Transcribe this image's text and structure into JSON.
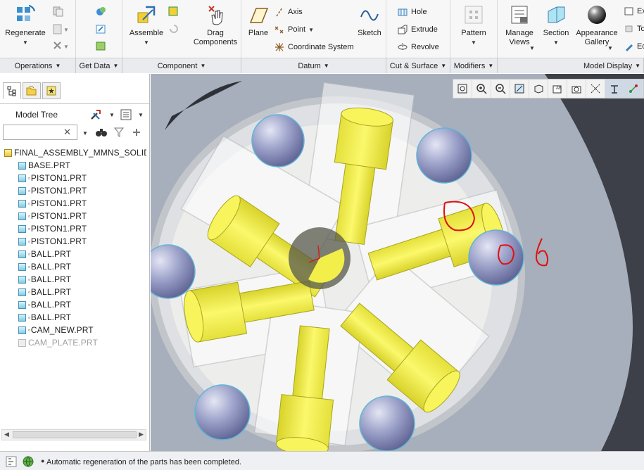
{
  "ribbon": {
    "operations": {
      "regenerate_label": "Regenerate",
      "group_label": "Operations"
    },
    "get_data": {
      "group_label": "Get Data"
    },
    "component": {
      "assemble_label": "Assemble",
      "drag_label": "Drag\nComponents",
      "group_label": "Component"
    },
    "datum": {
      "plane_label": "Plane",
      "axis_label": "Axis",
      "point_label": "Point",
      "coord_label": "Coordinate System",
      "sketch_label": "Sketch",
      "group_label": "Datum"
    },
    "cut_surface": {
      "hole_label": "Hole",
      "extrude_label": "Extrude",
      "revolve_label": "Revolve",
      "group_label": "Cut & Surface"
    },
    "modifiers": {
      "pattern_label": "Pattern",
      "group_label": "Modifiers"
    },
    "model_display": {
      "manage_views_label": "Manage\nViews",
      "section_label": "Section",
      "appearance_label": "Appearance\nGallery",
      "edit_partial_1": "Ex",
      "edit_partial_2": "To",
      "edit_partial_3": "Ed",
      "group_label": "Model Display"
    }
  },
  "model_tree": {
    "title": "Model Tree",
    "search_value": "",
    "items": [
      {
        "label": "FINAL_ASSEMBLY_MMNS_SOLID",
        "type": "assembly"
      },
      {
        "label": "BASE.PRT",
        "type": "part"
      },
      {
        "label": "PISTON1.PRT",
        "type": "part",
        "marker": true
      },
      {
        "label": "PISTON1.PRT",
        "type": "part",
        "marker": true
      },
      {
        "label": "PISTON1.PRT",
        "type": "part",
        "marker": true
      },
      {
        "label": "PISTON1.PRT",
        "type": "part",
        "marker": true
      },
      {
        "label": "PISTON1.PRT",
        "type": "part",
        "marker": true
      },
      {
        "label": "PISTON1.PRT",
        "type": "part",
        "marker": true
      },
      {
        "label": "BALL.PRT",
        "type": "part",
        "marker": true
      },
      {
        "label": "BALL.PRT",
        "type": "part",
        "marker": true
      },
      {
        "label": "BALL.PRT",
        "type": "part",
        "marker": true
      },
      {
        "label": "BALL.PRT",
        "type": "part",
        "marker": true
      },
      {
        "label": "BALL.PRT",
        "type": "part",
        "marker": true
      },
      {
        "label": "BALL.PRT",
        "type": "part",
        "marker": true
      },
      {
        "label": "CAM_NEW.PRT",
        "type": "part",
        "marker": true
      },
      {
        "label": "CAM_PLATE.PRT",
        "type": "part",
        "dim": true
      }
    ]
  },
  "status": {
    "message": "Automatic regeneration of the parts has been completed."
  },
  "colors": {
    "accent": "#3d7fb5",
    "piston_yellow": "#f2ef4a",
    "ball": "#8f95bf",
    "annotation_red": "#e01010"
  }
}
